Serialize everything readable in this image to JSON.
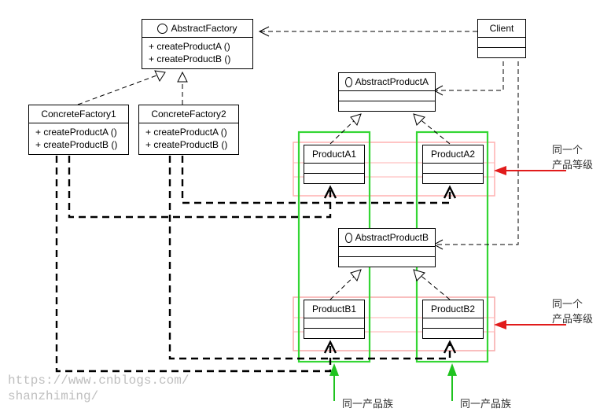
{
  "classes": {
    "abstractFactory": {
      "name": "AbstractFactory",
      "ops": [
        "+ createProductA ()",
        "+ createProductB ()"
      ]
    },
    "concreteFactory1": {
      "name": "ConcreteFactory1",
      "ops": [
        "+ createProductA ()",
        "+ createProductB ()"
      ]
    },
    "concreteFactory2": {
      "name": "ConcreteFactory2",
      "ops": [
        "+ createProductA ()",
        "+ createProductB ()"
      ]
    },
    "client": {
      "name": "Client"
    },
    "abstractProductA": {
      "name": "AbstractProductA"
    },
    "abstractProductB": {
      "name": "AbstractProductB"
    },
    "productA1": {
      "name": "ProductA1"
    },
    "productA2": {
      "name": "ProductA2"
    },
    "productB1": {
      "name": "ProductB1"
    },
    "productB2": {
      "name": "ProductB2"
    }
  },
  "annotations": {
    "levelA": {
      "line1": "同一个",
      "line2": "产品等级"
    },
    "levelB": {
      "line1": "同一个",
      "line2": "产品等级"
    },
    "family1": "同一产品族",
    "family2": "同一产品族"
  },
  "watermark": {
    "line1": "https://www.cnblogs.com/",
    "line2": "shanzhiming/"
  },
  "colors": {
    "family": "#34d634",
    "level": "#ffb0b0",
    "redArrow": "#e11b1b",
    "greenArrow": "#1fc31f"
  }
}
